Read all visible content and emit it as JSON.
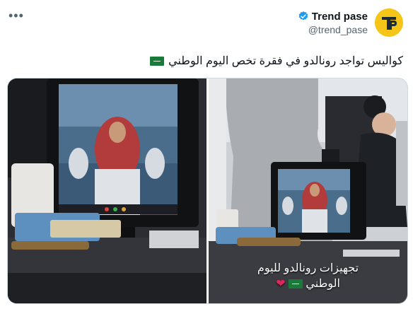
{
  "tweet": {
    "display_name": "Trend pase",
    "handle": "@trend_pase",
    "more_icon": "more-icon",
    "text": "كواليس تواجد رونالدو في فقرة تخص اليوم الوطني",
    "text_emoji": "saudi-flag-icon"
  },
  "media": {
    "right_caption_line1": "تجهيزات رونالدو لليوم",
    "right_caption_line2": "الوطني",
    "caption_emojis": [
      "saudi-flag-icon",
      "red-heart-icon"
    ]
  },
  "colors": {
    "brand_yellow": "#f5c518",
    "verified_blue": "#1d9bf0",
    "saudi_green": "#1a7a3a",
    "heart_red": "#e0245e"
  }
}
